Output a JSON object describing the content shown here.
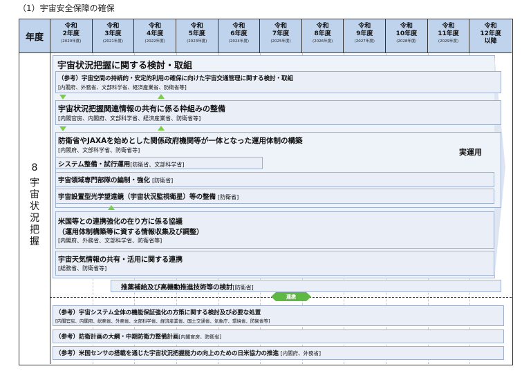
{
  "heading": "（1）宇宙安全保障の確保",
  "header_label": "年度",
  "years": [
    {
      "l1": "令和",
      "l2": "2年度",
      "l3": "(2020年度)"
    },
    {
      "l1": "令和",
      "l2": "3年度",
      "l3": "(2021年度)"
    },
    {
      "l1": "令和",
      "l2": "4年度",
      "l3": "(2022年度)"
    },
    {
      "l1": "令和",
      "l2": "5年度",
      "l3": "(2023年度)"
    },
    {
      "l1": "令和",
      "l2": "6年度",
      "l3": "(2024年度)"
    },
    {
      "l1": "令和",
      "l2": "7年度",
      "l3": "(2025年度)"
    },
    {
      "l1": "令和",
      "l2": "8年度",
      "l3": "(2026年度)"
    },
    {
      "l1": "令和",
      "l2": "9年度",
      "l3": "(2027年度)"
    },
    {
      "l1": "令和",
      "l2": "10年度",
      "l3": "(2028年度)"
    },
    {
      "l1": "令和",
      "l2": "11年度",
      "l3": "(2029年度)"
    },
    {
      "l1": "令和",
      "l2": "12年度",
      "l3": "以降"
    }
  ],
  "side": {
    "num": "8",
    "text": "宇宙状況把握"
  },
  "items": {
    "main_title": "宇宙状況把握に関する検討・取組",
    "ref1_title": "（参考）宇宙空間の持続的・安定的利用の確保に向けた宇宙交通管理に関する検討・取組",
    "ref1_orgs": "[内閣府、外務省、文部科学省、経済産業省、防衛省等]",
    "share_title": "宇宙状況把握関連情報の共有に係る枠組みの整備",
    "share_orgs": "[内閣官房、内閣府、文部科学省、経済産業省、防衛省等]",
    "ops_title": "防衛省やJAXAを始めとした関係政府機関等が一体となった運用体制の構築",
    "ops_orgs": "[内閣府、文部科学省、防衛省等]",
    "jitsu": "実運用",
    "sys_title": "システム整備・試行運用",
    "sys_orgs": "[防衛省、文部科学省]",
    "unit_title": "宇宙領域専門部隊の編制・強化",
    "unit_orgs": "[防衛省]",
    "tele_title": "宇宙設置型光学望遠鏡（宇宙状況監視衛星）等の整備",
    "tele_orgs": "[防衛省]",
    "us_title1": "米国等との連携強化の在り方に係る協議",
    "us_title2": "（運用体制構築等に資する情報収集及び調整）",
    "us_orgs": "[内閣府、外務省、文部科学省、防衛省等]",
    "wx_title": "宇宙天気情報の共有・活用に関する連携",
    "wx_orgs": "[総務省、防衛省等]",
    "prop_title": "推薬補給及び高機動推進技術等の検討",
    "prop_orgs": "[防衛省]",
    "rendo": "連携",
    "ref2_title": "（参考）宇宙システム全体の機能保証強化の方策に関する検討及び必要な処置",
    "ref2_orgs": "[内閣官房、内閣府、総務省、外務省、文部科学省、経済産業省、国土交通省、気象庁、環境省、防衛省等]",
    "ref3_title": "（参考）防衛計画の大綱・中期防衛力整備計画",
    "ref3_orgs": "[内閣官房、防衛省]",
    "ref4_title": "（参考）米国センサの搭載を通じた宇宙状況把握能力の向上のための日米協力の推進",
    "ref4_orgs": "[内閣府、外務省]"
  },
  "colors": {
    "header_bg": "#bfd3ec",
    "bar_bg": "#e9eef7",
    "accent_green": "#5fb843"
  }
}
